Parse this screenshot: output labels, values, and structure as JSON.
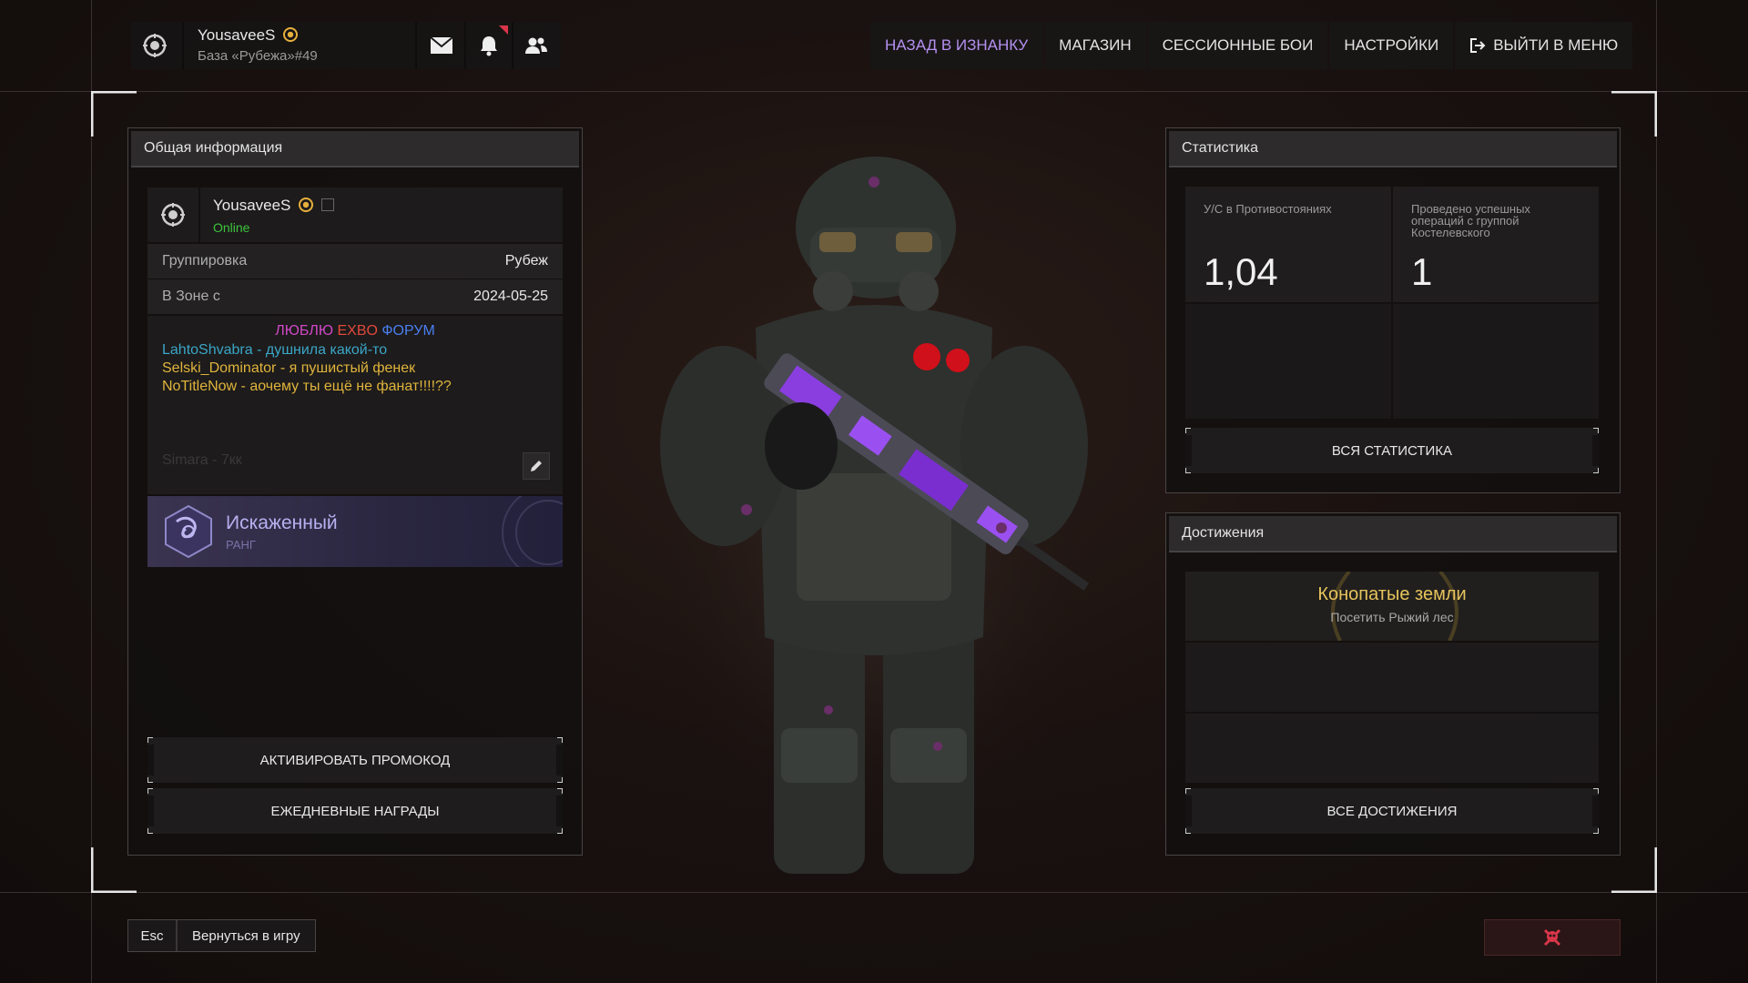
{
  "top_bar": {
    "username": "YousaveeS",
    "base": "База «Рубежа»#49",
    "icons": [
      "emblem-icon",
      "mail-icon",
      "bell-icon",
      "friends-icon"
    ],
    "nav": [
      {
        "label": "НАЗАД В ИЗНАНКУ",
        "active": true
      },
      {
        "label": "МАГАЗИН",
        "active": false
      },
      {
        "label": "СЕССИОННЫЕ БОИ",
        "active": false
      },
      {
        "label": "НАСТРОЙКИ",
        "active": false
      },
      {
        "label": "ВЫЙТИ В МЕНЮ",
        "active": false,
        "icon": "exit-icon"
      }
    ]
  },
  "info_panel": {
    "title": "Общая информация",
    "username": "YousaveeS",
    "status": "Online",
    "rows": [
      {
        "key": "Группировка",
        "value": "Рубеж"
      },
      {
        "key": "В Зоне с",
        "value": "2024-05-25"
      }
    ],
    "bio": {
      "header_parts": [
        {
          "text": "ЛЮБЛЮ ",
          "color": "#d048c8"
        },
        {
          "text": "EXBO ",
          "color": "#e0483c"
        },
        {
          "text": "ФОРУМ",
          "color": "#4a7ef0"
        }
      ],
      "lines": [
        {
          "text": "LahtoShvabra - душнила какой-то",
          "color": "#3aa6c8"
        },
        {
          "text": "Selski_Dominator - я пушистый фенек",
          "color": "#e0b43c"
        },
        {
          "text": "NoTitleNow - аочему ты ещё не фанат!!!!??",
          "color": "#e0b43c"
        }
      ],
      "faded_line": "Simara - 7кк"
    },
    "rank": {
      "name": "Искаженный",
      "label": "РАНГ"
    },
    "buttons": [
      "АКТИВИРОВАТЬ ПРОМОКОД",
      "ЕЖЕДНЕВНЫЕ НАГРАДЫ"
    ]
  },
  "stats_panel": {
    "title": "Статистика",
    "cells": [
      {
        "label": "У/С в Противостояниях",
        "value": "1,04"
      },
      {
        "label": "Проведено успешных операций с группой Костелевского",
        "value": "1"
      }
    ],
    "button": "ВСЯ СТАТИСТИКА"
  },
  "achievements_panel": {
    "title": "Достижения",
    "achievement": {
      "title": "Конопатые земли",
      "desc": "Посетить Рыжий лес"
    },
    "button": "ВСЕ ДОСТИЖЕНИЯ"
  },
  "bottom": {
    "esc_key": "Esc",
    "return_label": "Вернуться в игру",
    "report_icon": "skull-icon"
  },
  "colors": {
    "accent_purple": "#b491f0",
    "online_green": "#3ec43e",
    "achievement_gold": "#e6c35c",
    "danger_red": "#d9364a"
  }
}
